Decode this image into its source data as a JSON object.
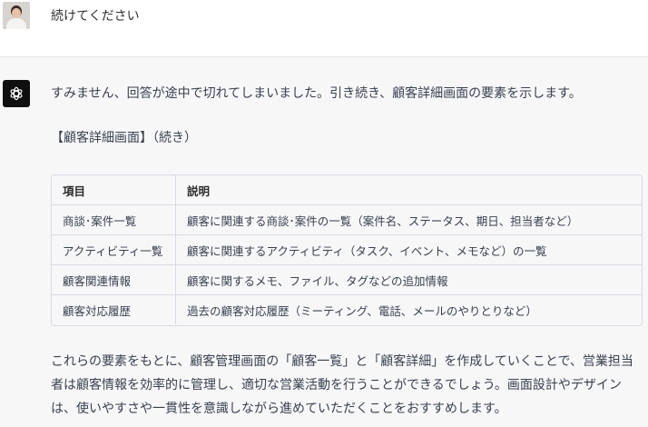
{
  "user_message": {
    "text": "続けてください"
  },
  "assistant_message": {
    "intro": "すみません、回答が途中で切れてしまいました。引き続き、顧客詳細画面の要素を示します。",
    "heading": "【顧客詳細画面】（続き）",
    "table": {
      "headers": [
        "項目",
        "説明"
      ],
      "rows": [
        [
          "商談･案件一覧",
          "顧客に関連する商談･案件の一覧（案件名、ステータス、期日、担当者など）"
        ],
        [
          "アクティビティ一覧",
          "顧客に関連するアクティビティ（タスク、イベント、メモなど）の一覧"
        ],
        [
          "顧客関連情報",
          "顧客に関するメモ、ファイル、タグなどの追加情報"
        ],
        [
          "顧客対応履歴",
          "過去の顧客対応履歴（ミーティング、電話、メールのやりとりなど）"
        ]
      ]
    },
    "closing": "これらの要素をもとに、顧客管理画面の「顧客一覧」と「顧客詳細」を作成していくことで、営業担当者は顧客情報を効率的に管理し、適切な営業活動を行うことができるでしょう。画面設計やデザインは、使いやすさや一貫性を意識しながら進めていただくことをおすすめします。"
  },
  "icons": {
    "user": "user-avatar",
    "assistant": "openai-logo-icon"
  },
  "colors": {
    "assistant_bg": "#f7f7f8",
    "logo_bg": "#0f0f0f",
    "border": "#d9d9e3"
  }
}
